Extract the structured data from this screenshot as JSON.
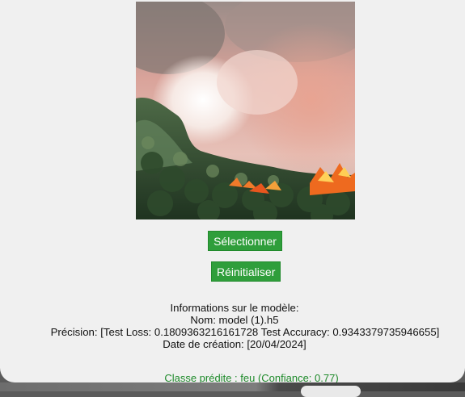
{
  "buttons": {
    "select_label": "Sélectionner",
    "reset_label": "Réinitialiser"
  },
  "model_info": {
    "heading": "Informations sur le modèle:",
    "name_line": "Nom: model (1).h5",
    "precision_line": "Précision: [Test Loss: 0.1809363216161728  Test Accuracy: 0.9343379735946655]",
    "date_line": "Date de création: [20/04/2024]"
  },
  "prediction": {
    "label": "Classe prédite :   feu (Confiance: 0.77)"
  },
  "colors": {
    "button_green": "#2f9e3b",
    "prediction_green": "#1e8a2a",
    "panel_bg": "#f0f0f0"
  }
}
